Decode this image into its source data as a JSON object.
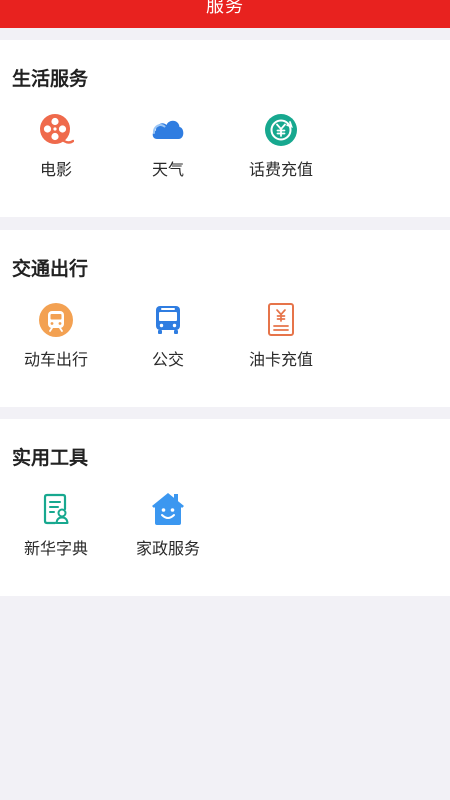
{
  "header": {
    "title": "服务",
    "color": "#e8221f"
  },
  "sections": [
    {
      "title": "生活服务",
      "items": [
        {
          "label": "电影",
          "icon": "film-reel-icon"
        },
        {
          "label": "天气",
          "icon": "cloud-icon"
        },
        {
          "label": "话费充值",
          "icon": "yuan-recharge-icon"
        }
      ]
    },
    {
      "title": "交通出行",
      "items": [
        {
          "label": "动车出行",
          "icon": "train-icon"
        },
        {
          "label": "公交",
          "icon": "bus-icon"
        },
        {
          "label": "油卡充值",
          "icon": "yuan-card-icon"
        }
      ]
    },
    {
      "title": "实用工具",
      "items": [
        {
          "label": "新华字典",
          "icon": "dictionary-icon"
        },
        {
          "label": "家政服务",
          "icon": "house-smile-icon"
        }
      ]
    }
  ]
}
